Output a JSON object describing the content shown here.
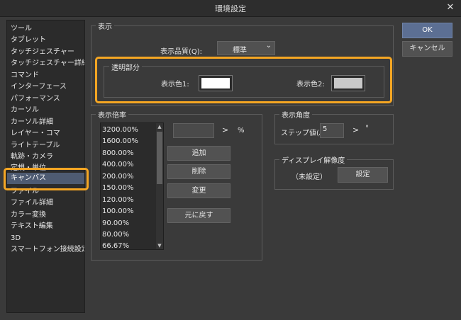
{
  "window": {
    "title": "環境設定",
    "close_icon": "close-icon"
  },
  "sidebar": {
    "items": [
      {
        "label": "ツール"
      },
      {
        "label": "タブレット"
      },
      {
        "label": "タッチジェスチャー"
      },
      {
        "label": "タッチジェスチャー詳細"
      },
      {
        "label": "コマンド"
      },
      {
        "label": "インターフェース"
      },
      {
        "label": "パフォーマンス"
      },
      {
        "label": "カーソル"
      },
      {
        "label": "カーソル詳細"
      },
      {
        "label": "レイヤー・コマ"
      },
      {
        "label": "ライトテーブル"
      },
      {
        "label": "軌跡・カメラ"
      },
      {
        "label": "定規・単位"
      },
      {
        "label": "キャンバス"
      },
      {
        "label": "ファイル"
      },
      {
        "label": "ファイル詳細"
      },
      {
        "label": "カラー変換"
      },
      {
        "label": "テキスト編集"
      },
      {
        "label": "3D"
      },
      {
        "label": "スマートフォン接続設定"
      }
    ],
    "selected": "キャンバス"
  },
  "display": {
    "title": "表示",
    "quality_label": "表示品質(Q):",
    "quality_value": "標準",
    "transparent": {
      "title": "透明部分",
      "color1_label": "表示色1:",
      "color2_label": "表示色2:",
      "color1": "#ffffff",
      "color2": "#c8c8c8"
    }
  },
  "zoom": {
    "title": "表示倍率",
    "values": [
      "3200.00%",
      "1600.00%",
      "800.00%",
      "400.00%",
      "200.00%",
      "150.00%",
      "120.00%",
      "100.00%",
      "90.00%",
      "80.00%",
      "66.67%"
    ],
    "unit": "%",
    "add_label": "追加",
    "delete_label": "削除",
    "change_label": "変更",
    "reset_label": "元に戻す"
  },
  "angle": {
    "title": "表示角度",
    "step_label": "ステップ値(A):",
    "step_value": "5",
    "unit": "°"
  },
  "resolution": {
    "title": "ディスプレイ解像度",
    "status": "（未設定）",
    "settings_label": "設定"
  },
  "buttons": {
    "ok": "OK",
    "cancel": "キャンセル"
  },
  "colors": {
    "highlight": "#f5a623",
    "selected": "#4e5b72",
    "primary": "#5c6f93"
  }
}
